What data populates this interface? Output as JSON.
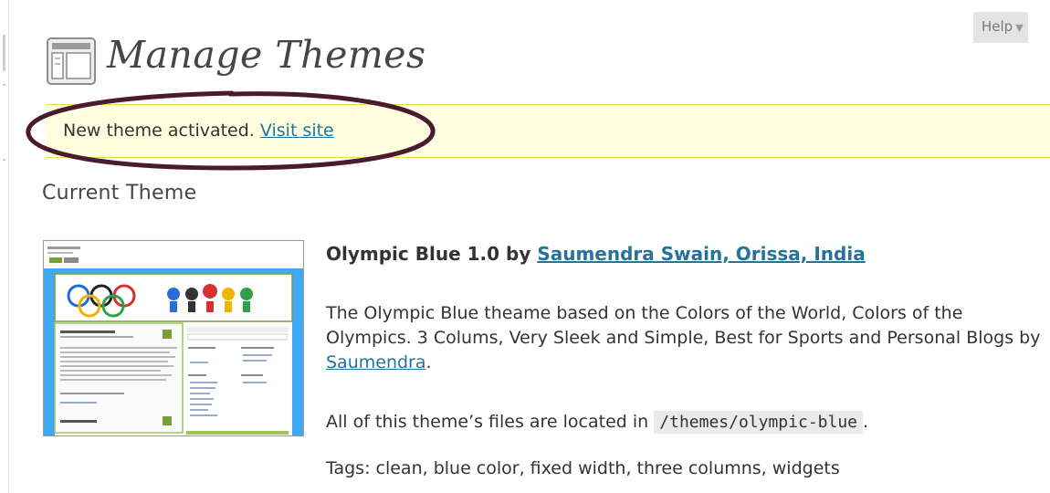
{
  "header": {
    "title": "Manage Themes",
    "help_label": "Help",
    "help_arrow": "▼",
    "icon": "appearance-icon"
  },
  "notice": {
    "message": "New theme activated.",
    "link_text": "Visit site",
    "highlight_color": "#4a1a2e"
  },
  "current_theme": {
    "heading": "Current Theme",
    "name_version": "Olympic Blue 1.0",
    "by_label": "by",
    "author": "Saumendra Swain, Orissa, India",
    "description_pre": "The Olympic Blue theame based on the Colors of the World, Colors of the Olympics. 3 Colums, Very Sleek and Simple, Best for Sports and Personal Blogs by ",
    "description_link": "Saumendra",
    "description_post": ".",
    "files_pre": "All of this theme’s files are located in",
    "files_path": "/themes/olympic-blue",
    "files_post": ".",
    "tags_label": "Tags:",
    "tags": "clean, blue color, fixed width, three columns, widgets"
  },
  "colors": {
    "link": "#21759b",
    "notice_bg": "#ffffe0",
    "notice_border": "#e6db55",
    "theme_header_blue": "#3fa9f5"
  }
}
